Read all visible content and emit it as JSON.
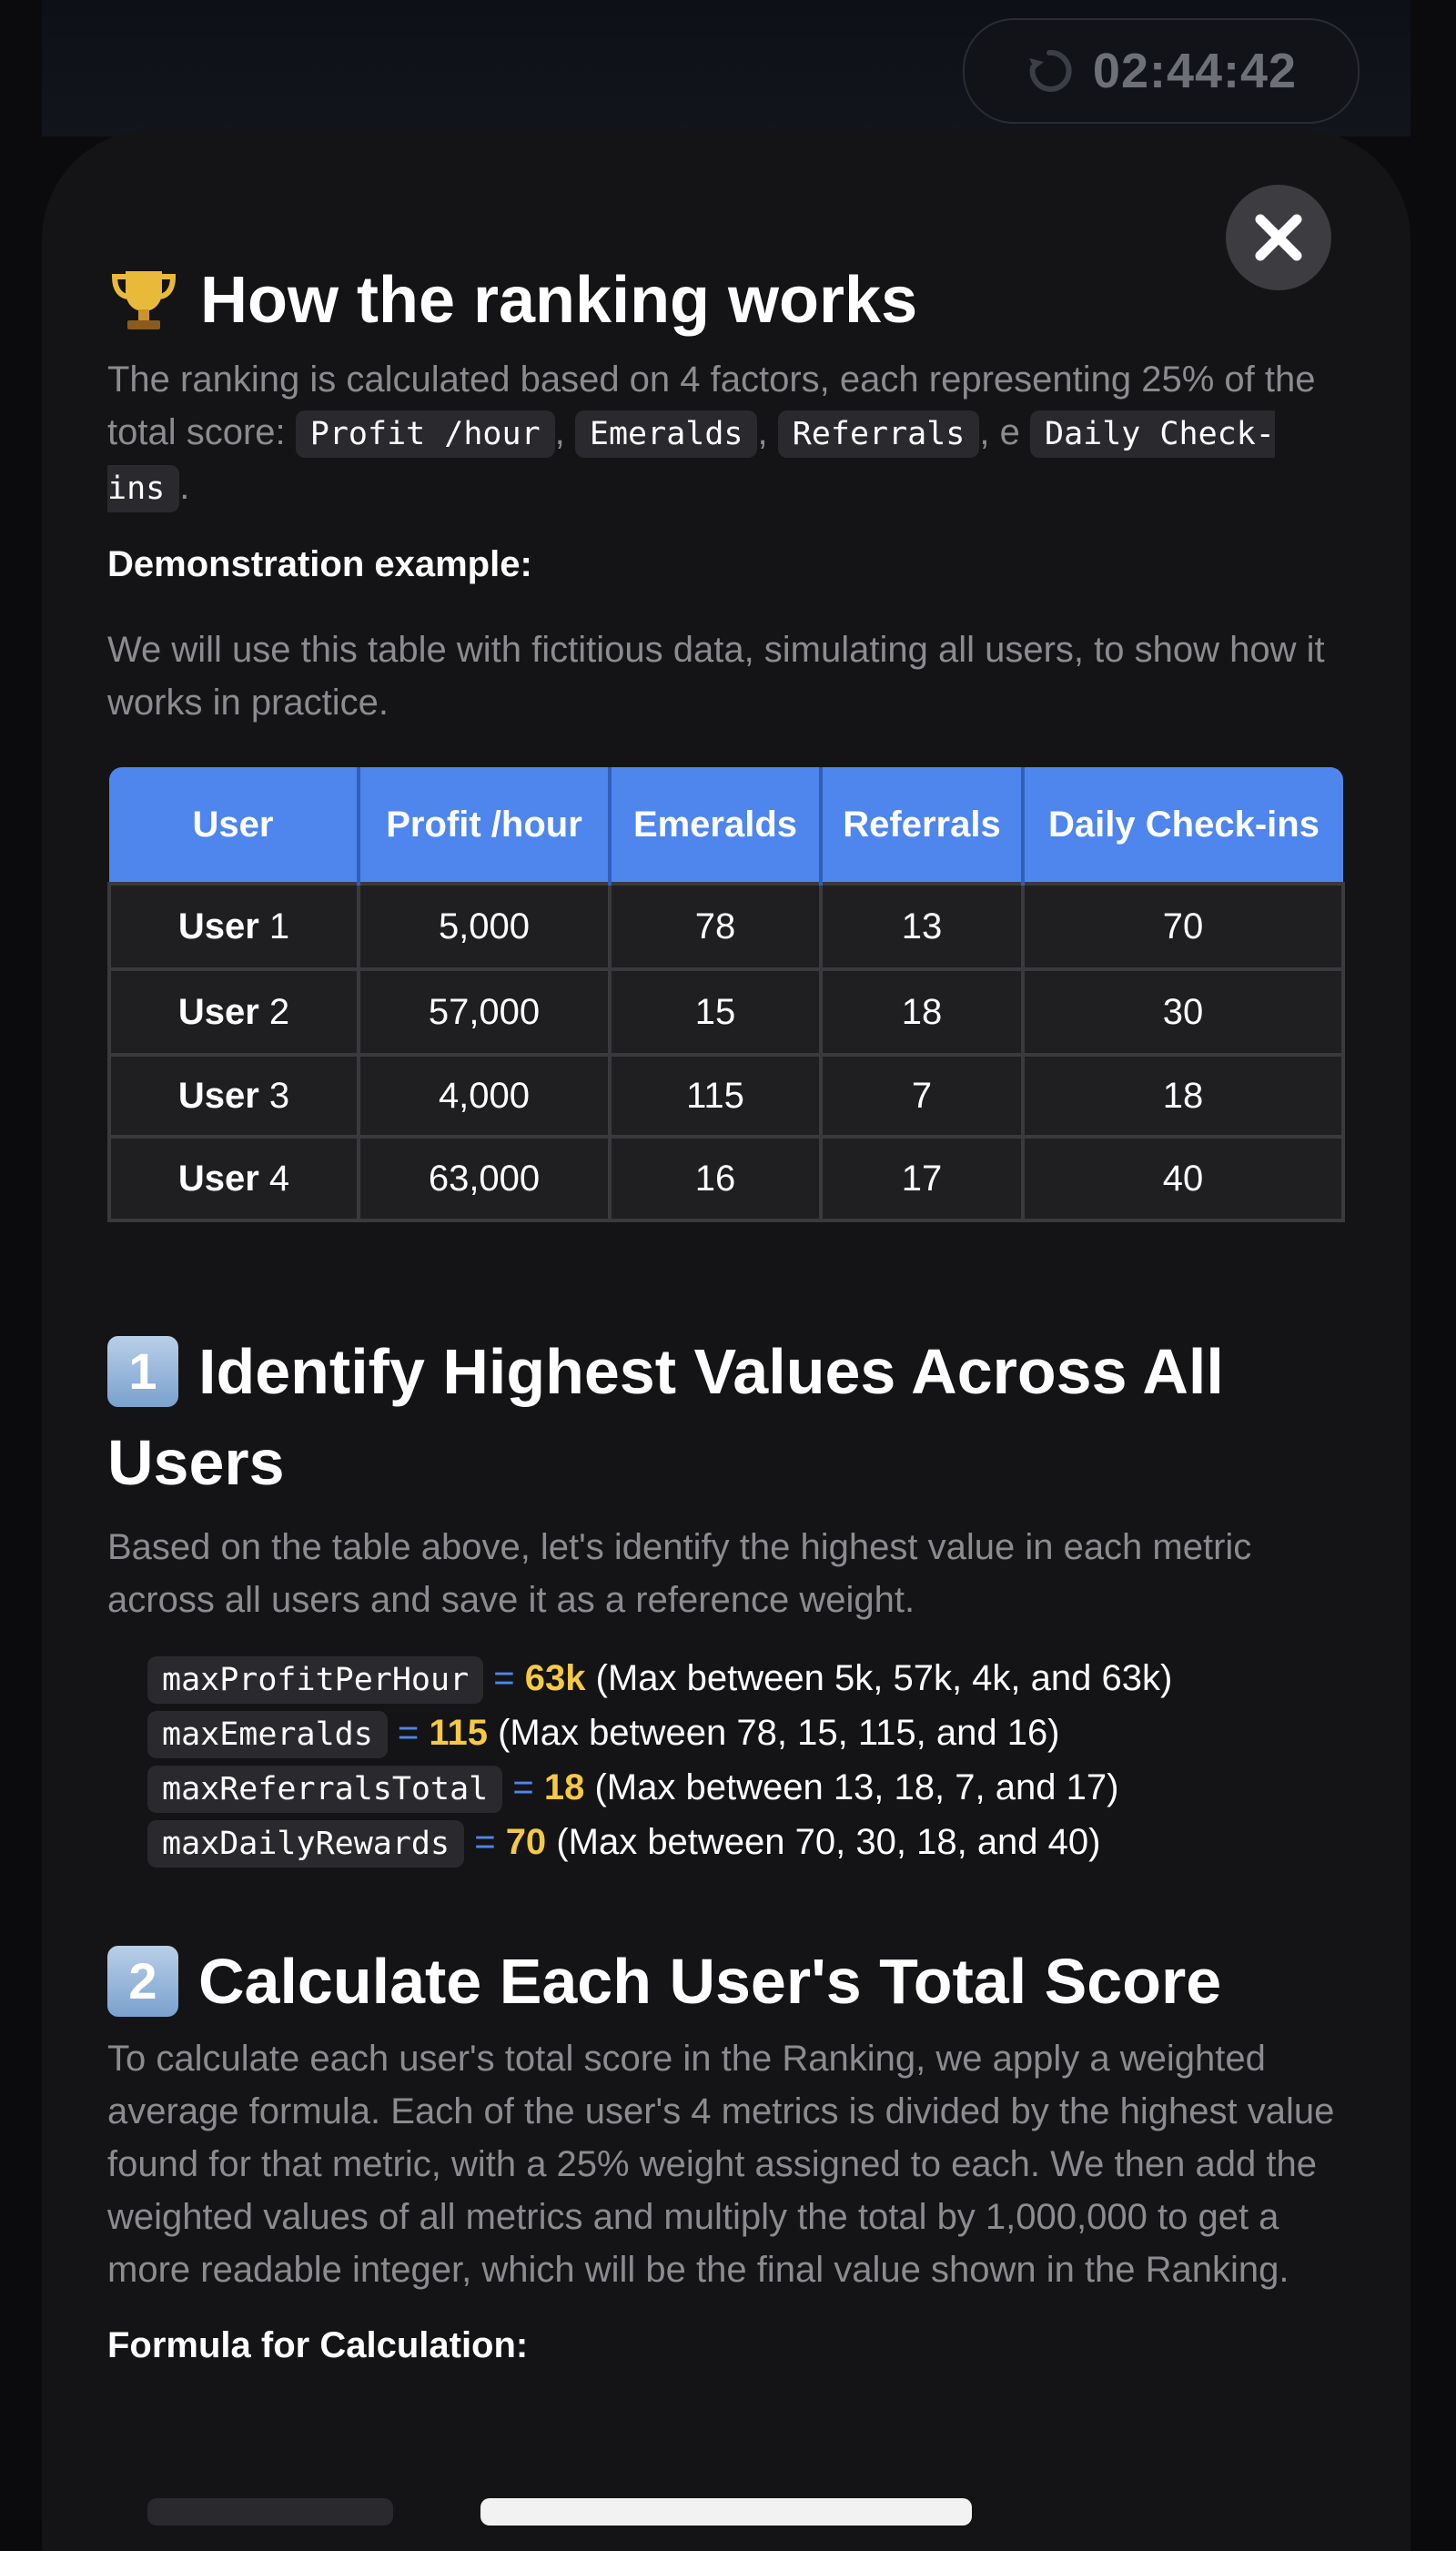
{
  "timer": {
    "value": "02:44:42",
    "icon": "refresh-timer-icon"
  },
  "close": {
    "icon": "close-icon"
  },
  "title": "How the ranking works",
  "intro": {
    "text_before": "The ranking is calculated based on 4 factors, each representing 25% of the total score:",
    "factors": [
      "Profit /hour",
      "Emeralds",
      "Referrals",
      "Daily Check-ins"
    ],
    "sep1": ",",
    "sep2": ",",
    "sep3": ", e",
    "end": "."
  },
  "demo_label": "Demonstration example:",
  "demo_text": "We will use this table with fictitious data, simulating all users, to show how it works in practice.",
  "table": {
    "headers": [
      "User",
      "Profit /hour",
      "Emeralds",
      "Referrals",
      "Daily Check-ins"
    ],
    "rows": [
      {
        "user_bold": "User",
        "user_num": "1",
        "profit": "5,000",
        "emeralds": "78",
        "referrals": "13",
        "checkins": "70"
      },
      {
        "user_bold": "User",
        "user_num": "2",
        "profit": "57,000",
        "emeralds": "15",
        "referrals": "18",
        "checkins": "30"
      },
      {
        "user_bold": "User",
        "user_num": "3",
        "profit": "4,000",
        "emeralds": "115",
        "referrals": "7",
        "checkins": "18"
      },
      {
        "user_bold": "User",
        "user_num": "4",
        "profit": "63,000",
        "emeralds": "16",
        "referrals": "17",
        "checkins": "40"
      }
    ]
  },
  "section1": {
    "badge": "1",
    "title": "Identify Highest Values Across All Users",
    "text": "Based on the table above, let's identify the highest value in each metric across all users and save it as a reference weight.",
    "items": [
      {
        "code": "maxProfitPerHour",
        "eq": "=",
        "value": "63k",
        "note": "(Max between 5k, 57k, 4k, and 63k)"
      },
      {
        "code": "maxEmeralds",
        "eq": "=",
        "value": "115",
        "note": "(Max between 78, 15, 115, and 16)"
      },
      {
        "code": "maxReferralsTotal",
        "eq": "=",
        "value": "18",
        "note": "(Max between 13, 18, 7, and 17)"
      },
      {
        "code": "maxDailyRewards",
        "eq": "=",
        "value": "70",
        "note": "(Max between 70, 30, 18, and 40)"
      }
    ]
  },
  "section2": {
    "badge": "2",
    "title": "Calculate Each User's Total Score",
    "text": "To calculate each user's total score in the Ranking, we apply a weighted average formula. Each of the user's 4 metrics is divided by the highest value found for that metric, with a 25% weight assigned to each. We then add the weighted values of all metrics and multiply the total by 1,000,000 to get a more readable integer, which will be the final value shown in the Ranking."
  },
  "formula_label": "Formula for Calculation:",
  "colors": {
    "accent_blue": "#4e86ee",
    "highlight_yellow": "#f5c945",
    "muted_text": "#8b8b90",
    "modal_bg": "#141416"
  }
}
